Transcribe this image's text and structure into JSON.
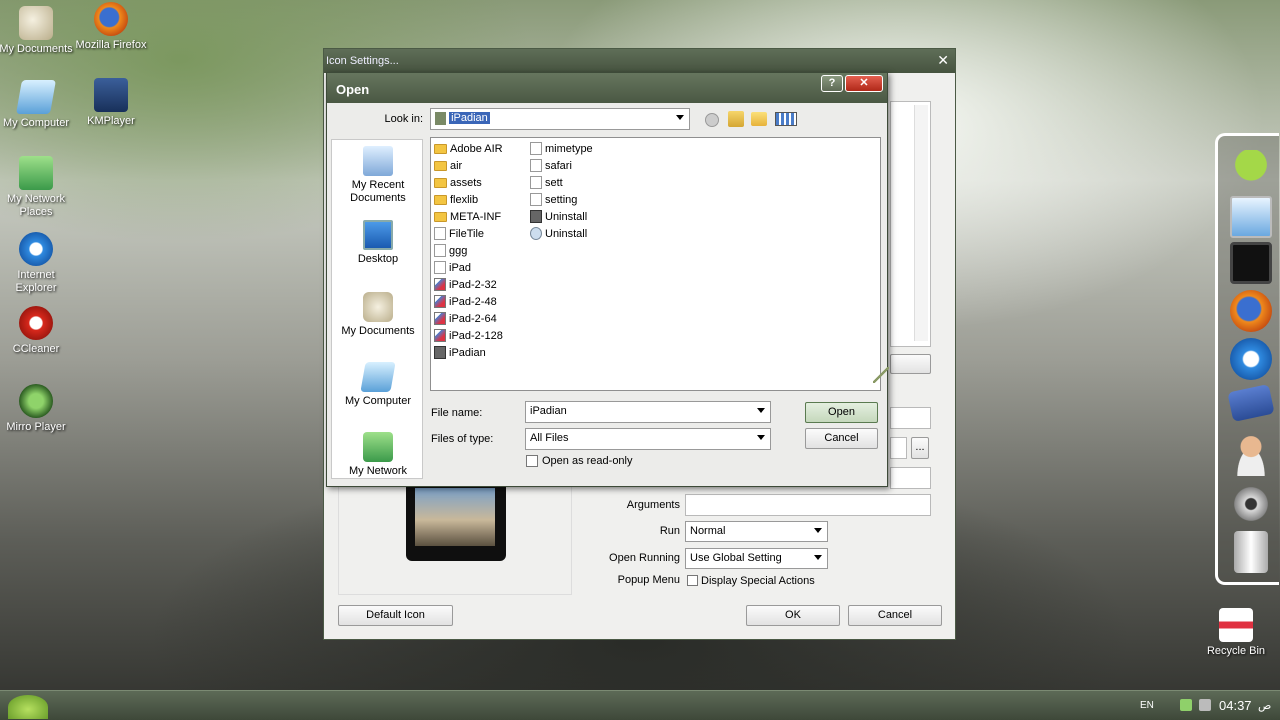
{
  "desktop": {
    "icons": [
      {
        "label": "My Documents",
        "icon": "my-documents-icon"
      },
      {
        "label": "Mozilla Firefox",
        "icon": "firefox-icon"
      },
      {
        "label": "My Computer",
        "icon": "my-computer-icon"
      },
      {
        "label": "KMPlayer",
        "icon": "kmplayer-icon"
      },
      {
        "label": "My Network Places",
        "icon": "network-places-icon"
      },
      {
        "label": "Internet Explorer",
        "icon": "internet-explorer-icon"
      },
      {
        "label": "CCleaner",
        "icon": "ccleaner-icon"
      },
      {
        "label": "Mirro Player",
        "icon": "mirro-player-icon"
      },
      {
        "label": "Recycle Bin",
        "icon": "recycle-bin-icon"
      }
    ]
  },
  "icon_settings": {
    "title": "Icon Settings...",
    "close": "✕",
    "arguments_label": "Arguments",
    "run_label": "Run",
    "run_value": "Normal",
    "open_running_label": "Open Running",
    "open_running_value": "Use Global Setting",
    "popup_menu_label": "Popup Menu",
    "display_special_actions": "Display Special Actions",
    "browse_label": "...",
    "default_icon": "Default Icon",
    "ok": "OK",
    "cancel": "Cancel"
  },
  "open_dialog": {
    "title": "Open",
    "help": "?",
    "close": "✕",
    "look_in_label": "Look in:",
    "look_in_value": "iPadian",
    "places": [
      "My Recent Documents",
      "Desktop",
      "My Documents",
      "My Computer",
      "My Network"
    ],
    "files_col1": [
      {
        "name": "Adobe AIR",
        "type": "folder"
      },
      {
        "name": "air",
        "type": "folder"
      },
      {
        "name": "assets",
        "type": "folder"
      },
      {
        "name": "flexlib",
        "type": "folder"
      },
      {
        "name": "META-INF",
        "type": "folder"
      },
      {
        "name": "FileTile",
        "type": "doc"
      },
      {
        "name": "ggg",
        "type": "doc"
      },
      {
        "name": "iPad",
        "type": "doc"
      },
      {
        "name": "iPad-2-32",
        "type": "png"
      },
      {
        "name": "iPad-2-48",
        "type": "png"
      },
      {
        "name": "iPad-2-64",
        "type": "png"
      },
      {
        "name": "iPad-2-128",
        "type": "png"
      },
      {
        "name": "iPadian",
        "type": "app"
      }
    ],
    "files_col2": [
      {
        "name": "mimetype",
        "type": "doc"
      },
      {
        "name": "safari",
        "type": "doc"
      },
      {
        "name": "sett",
        "type": "doc"
      },
      {
        "name": "setting",
        "type": "doc"
      },
      {
        "name": "Uninstall",
        "type": "app"
      },
      {
        "name": "Uninstall",
        "type": "gear"
      }
    ],
    "file_name_label": "File name:",
    "file_name_value": "iPadian",
    "files_of_type_label": "Files of type:",
    "files_of_type_value": "All Files",
    "read_only_label": "Open as read-only",
    "open_button": "Open",
    "cancel_button": "Cancel"
  },
  "taskbar": {
    "lang": "EN",
    "time": "04:37",
    "ampm": "ص"
  }
}
